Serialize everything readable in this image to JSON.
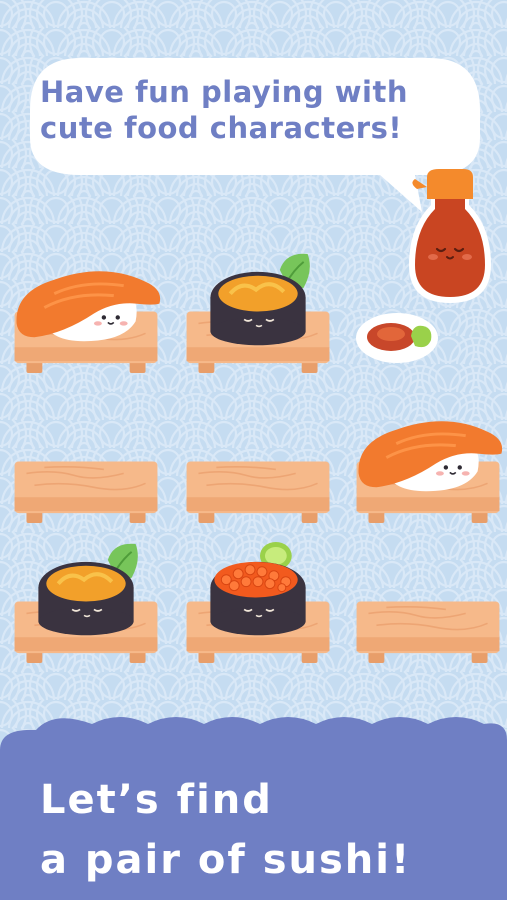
{
  "speech_bubble": {
    "line1": "Have fun playing with",
    "line2": "cute food characters!"
  },
  "footer": {
    "line1": "Let’s find",
    "line2": "a pair of sushi!"
  },
  "colors": {
    "background": "#c5dcf1",
    "wave_pattern": "#d6e6f6",
    "bubble_text": "#6f7fc4",
    "footer_band": "#6f7fc4",
    "board_wood": "#f6b98a",
    "salmon": "#f27a2e",
    "seaweed": "#3a3340",
    "soy_sauce": "#c84a25"
  },
  "board": {
    "tiles": [
      {
        "name": "salmon-nigiri",
        "content": "salmon-nigiri"
      },
      {
        "name": "uni-gunkan",
        "content": "uni-gunkan"
      },
      {
        "name": "empty",
        "content": "empty"
      },
      {
        "name": "salmon-nigiri",
        "content": "salmon-nigiri"
      },
      {
        "name": "uni-gunkan",
        "content": "uni-gunkan"
      },
      {
        "name": "ikura-gunkan",
        "content": "ikura-gunkan"
      },
      {
        "name": "empty",
        "content": "empty"
      },
      {
        "name": "empty",
        "content": "empty"
      }
    ]
  }
}
